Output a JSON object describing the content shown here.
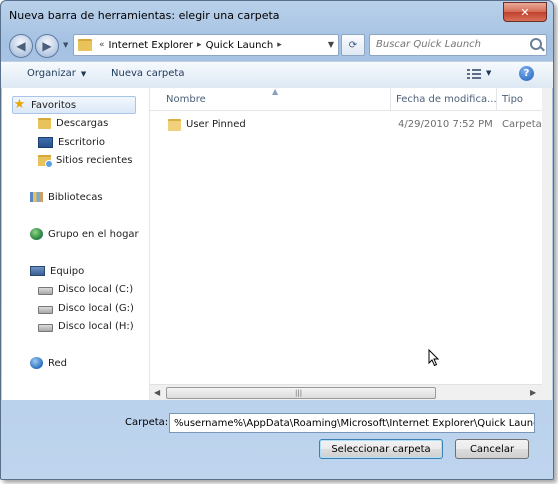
{
  "window": {
    "title": "Nueva barra de herramientas: elegir una carpeta",
    "close_label": "✕"
  },
  "address": {
    "prefix": "«",
    "crumbs": [
      "Internet Explorer",
      "Quick Launch"
    ],
    "separator": "▸"
  },
  "search": {
    "placeholder": "Buscar Quick Launch"
  },
  "toolbar": {
    "organize_label": "Organizar",
    "new_folder_label": "Nueva carpeta",
    "help_label": "?"
  },
  "sidebar": {
    "favorites": {
      "label": "Favoritos",
      "items": [
        "Descargas",
        "Escritorio",
        "Sitios recientes"
      ]
    },
    "libraries_label": "Bibliotecas",
    "homegroup_label": "Grupo en el hogar",
    "computer": {
      "label": "Equipo",
      "drives": [
        "Disco local (C:)",
        "Disco local (G:)",
        "Disco local (H:)"
      ]
    },
    "network_label": "Red"
  },
  "filelist": {
    "columns": [
      "Nombre",
      "Fecha de modifica...",
      "Tipo"
    ],
    "rows": [
      {
        "name": "User Pinned",
        "date": "4/29/2010 7:52 PM",
        "type": "Carpeta d"
      }
    ]
  },
  "bottom": {
    "folder_label": "Carpeta:",
    "folder_value": "%username%\\AppData\\Roaming\\Microsoft\\Internet Explorer\\Quick Launch",
    "select_button": "Seleccionar carpeta",
    "cancel_button": "Cancelar"
  }
}
